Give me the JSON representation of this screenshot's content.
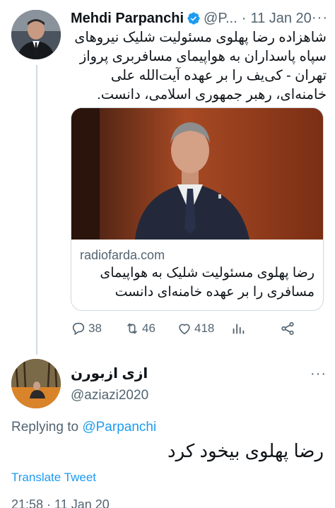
{
  "tweet": {
    "author_name": "Mehdi Parpanchi",
    "handle": "@P...",
    "separator": "·",
    "date": "11 Jan 20",
    "more_icon": "···",
    "text": "شاهزاده رضا پهلوی مسئولیت شلیک نیروهای سپاه پاسداران به هواپیمای مسافربری پرواز تهران - کی‌یف را بر عهده آیت‌الله علی خامنه‌ای، رهبر جمهوری اسلامی، دانست.",
    "card": {
      "domain": "radiofarda.com",
      "title": "رضا پهلوی مسئولیت شلیک به هواپیمای مسافری را بر عهده خامنه‌ای دانست"
    },
    "actions": {
      "replies": "38",
      "retweets": "46",
      "likes": "418"
    }
  },
  "reply": {
    "author_name": "ازی ازبورن",
    "handle": "@aziazi2020",
    "more_icon": "···",
    "replying_prefix": "Replying to",
    "replying_to": "@Parpanchi",
    "text": "رضا پهلوی بیخود کرد",
    "translate_label": "Translate Tweet",
    "timestamp": "21:58 · 11 Jan 20"
  },
  "colors": {
    "accent": "#1d9bf0",
    "secondary_text": "#536471",
    "primary_text": "#0f1419",
    "border": "#cfd9de"
  },
  "icons": [
    "verified-badge-icon",
    "more-icon",
    "reply-icon",
    "retweet-icon",
    "like-icon",
    "analytics-icon",
    "share-icon"
  ]
}
